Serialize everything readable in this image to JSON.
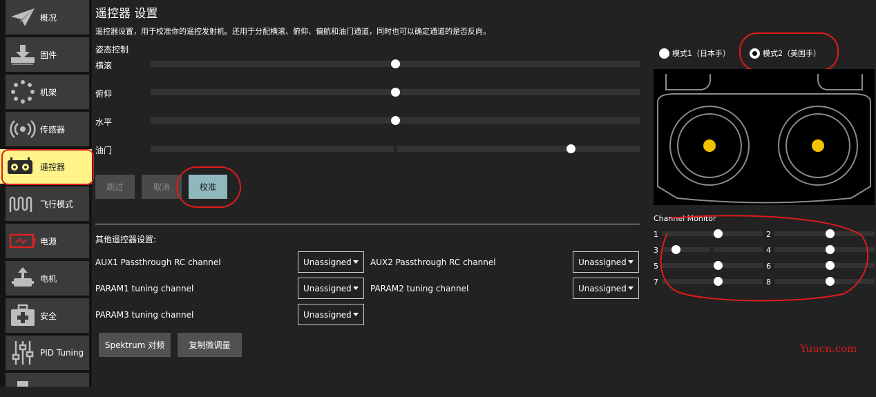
{
  "sidebar": {
    "items": [
      {
        "label": "概况",
        "icon": "paper-plane-icon"
      },
      {
        "label": "固件",
        "icon": "download-icon"
      },
      {
        "label": "机架",
        "icon": "frame-dots-icon"
      },
      {
        "label": "传感器",
        "icon": "sensor-waves-icon"
      },
      {
        "label": "遥控器",
        "icon": "remote-controller-icon"
      },
      {
        "label": "飞行模式",
        "icon": "waveform-icon"
      },
      {
        "label": "电源",
        "icon": "battery-icon"
      },
      {
        "label": "电机",
        "icon": "motor-icon"
      },
      {
        "label": "安全",
        "icon": "first-aid-icon"
      },
      {
        "label": "PID Tuning",
        "icon": "sliders-icon"
      }
    ],
    "active_index": 4,
    "active_color": "#fff38a"
  },
  "main": {
    "title": "遥控器 设置",
    "description": "遥控器设置，用于校准你的遥控发射机。还用于分配横滚、俯仰、偏航和油门通道，同时也可以确定通道的是否反向。",
    "attitude_section": "姿态控制",
    "axes": [
      {
        "label": "横滚",
        "value": 0.5
      },
      {
        "label": "俯仰",
        "value": 0.5
      },
      {
        "label": "水平",
        "value": 0.5
      },
      {
        "label": "油门",
        "value": 0.86
      }
    ],
    "buttons": {
      "skip": "跳过",
      "cancel": "取消",
      "calibrate": "校准"
    },
    "other_section": "其他遥控器设置:",
    "options": [
      {
        "label": "AUX1 Passthrough RC channel",
        "value": "Unassigned"
      },
      {
        "label": "AUX2 Passthrough RC channel",
        "value": "Unassigned"
      },
      {
        "label": "PARAM1 tuning channel",
        "value": "Unassigned"
      },
      {
        "label": "PARAM2 tuning channel",
        "value": "Unassigned"
      },
      {
        "label": "PARAM3 tuning channel",
        "value": "Unassigned"
      }
    ],
    "bottom_buttons": {
      "spektrum": "Spektrum 对频",
      "copy_trims": "复制微调量"
    }
  },
  "right_panel": {
    "modes": [
      {
        "label": "模式1（日本手）",
        "checked": false
      },
      {
        "label": "模式2（美国手）",
        "checked": true
      }
    ],
    "stick_color": "#f2c200",
    "channel_monitor": {
      "title": "Channel Monitor",
      "channels": [
        {
          "num": "1",
          "value": 0.5
        },
        {
          "num": "2",
          "value": 0.5
        },
        {
          "num": "3",
          "value": 0.0
        },
        {
          "num": "4",
          "value": 0.5
        },
        {
          "num": "5",
          "value": 0.5
        },
        {
          "num": "6",
          "value": 0.5
        },
        {
          "num": "7",
          "value": 0.5
        },
        {
          "num": "8",
          "value": 0.5
        }
      ]
    }
  },
  "watermark": "Yuucn.com",
  "annotation_color": "#e01b1b"
}
